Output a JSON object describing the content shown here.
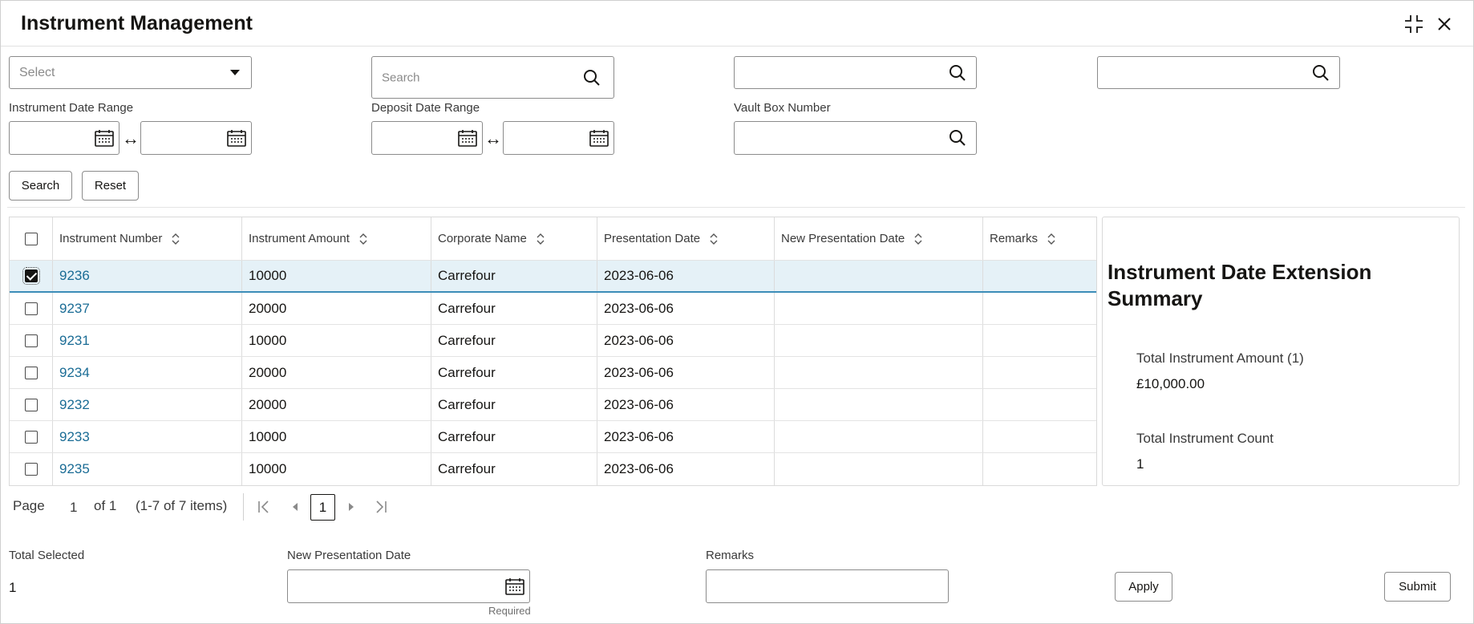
{
  "window": {
    "title": "Instrument Management"
  },
  "filters": {
    "select_placeholder": "Select",
    "search_placeholder": "Search",
    "instrument_date_range_label": "Instrument Date Range",
    "deposit_date_range_label": "Deposit Date Range",
    "vault_box_label": "Vault Box Number",
    "range_arrow": "↔",
    "search_button": "Search",
    "reset_button": "Reset"
  },
  "table": {
    "columns": [
      "Instrument Number",
      "Instrument Amount",
      "Corporate Name",
      "Presentation Date",
      "New Presentation Date",
      "Remarks"
    ],
    "rows": [
      {
        "number": "9236",
        "amount": "10000",
        "corporate": "Carrefour",
        "date": "2023-06-06",
        "new_date": "",
        "remarks": "",
        "selected": true
      },
      {
        "number": "9237",
        "amount": "20000",
        "corporate": "Carrefour",
        "date": "2023-06-06",
        "new_date": "",
        "remarks": "",
        "selected": false
      },
      {
        "number": "9231",
        "amount": "10000",
        "corporate": "Carrefour",
        "date": "2023-06-06",
        "new_date": "",
        "remarks": "",
        "selected": false
      },
      {
        "number": "9234",
        "amount": "20000",
        "corporate": "Carrefour",
        "date": "2023-06-06",
        "new_date": "",
        "remarks": "",
        "selected": false
      },
      {
        "number": "9232",
        "amount": "20000",
        "corporate": "Carrefour",
        "date": "2023-06-06",
        "new_date": "",
        "remarks": "",
        "selected": false
      },
      {
        "number": "9233",
        "amount": "10000",
        "corporate": "Carrefour",
        "date": "2023-06-06",
        "new_date": "",
        "remarks": "",
        "selected": false
      },
      {
        "number": "9235",
        "amount": "10000",
        "corporate": "Carrefour",
        "date": "2023-06-06",
        "new_date": "",
        "remarks": "",
        "selected": false
      }
    ]
  },
  "summary": {
    "title": "Instrument Date Extension Summary",
    "total_amount_label": "Total Instrument Amount (1)",
    "total_amount_value": "£10,000.00",
    "total_count_label": "Total Instrument Count",
    "total_count_value": "1"
  },
  "pagination": {
    "page_label": "Page",
    "page_value": "1",
    "of_label": "of 1",
    "items_label": "(1-7 of 7 items)",
    "current_page": "1"
  },
  "footer": {
    "total_selected_label": "Total Selected",
    "total_selected_value": "1",
    "new_presentation_date_label": "New Presentation Date",
    "required_text": "Required",
    "remarks_label": "Remarks",
    "apply_button": "Apply",
    "submit_button": "Submit"
  }
}
